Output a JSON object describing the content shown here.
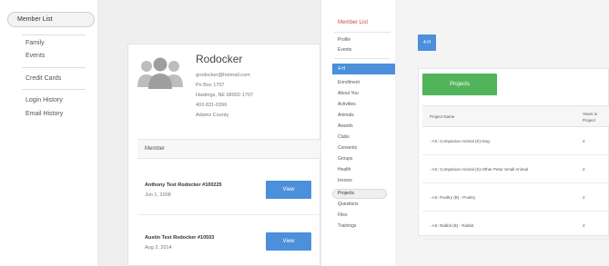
{
  "left": {
    "nav": {
      "active": "Member List",
      "group1": [
        "Family",
        "Events"
      ],
      "group2": [
        "Credit Cards"
      ],
      "group3": [
        "Login History",
        "Email History"
      ]
    },
    "profile": {
      "name": "Rodocker",
      "email": "grodocker@hotmail.com",
      "address1": "Po Box 1707",
      "address2": "Hastings, NE 68902-1707",
      "phone": "402-831-0396",
      "county": "Adams County"
    },
    "member_section": {
      "header": "Member",
      "rows": [
        {
          "name": "Anthony Test Rodocker #100225",
          "date": "Jun 1, 2008",
          "button": "View"
        },
        {
          "name": "Austin Test Rodocker #10503",
          "date": "Aug 2, 2014",
          "button": "View"
        }
      ]
    }
  },
  "right": {
    "sidebar": {
      "heading": "Member List",
      "top_items": [
        "Profile",
        "Events"
      ],
      "active_item": "4-H",
      "items": [
        "Enrollment",
        "About You",
        "Activities",
        "Animals",
        "Awards",
        "Clubs",
        "Consents",
        "Groups",
        "Health",
        "Invoice",
        "Projects",
        "Questions",
        "Files",
        "Trainings"
      ],
      "selected_item": "Projects"
    },
    "badge": "4-H",
    "projects_button": "Projects",
    "table": {
      "headers": {
        "project": "Project Name",
        "years": "Years in Project"
      },
      "rows": [
        {
          "project": "- AS: Companion Animal (K)-Dog",
          "years": "4"
        },
        {
          "project": "- AS: Companion Animal (S)-Other Petor Small Animal",
          "years": "2"
        },
        {
          "project": "- AS: Poultry (B) - Poultry",
          "years": "2"
        },
        {
          "project": "- AS: Rabbit (B) - Rabbit",
          "years": "4"
        }
      ]
    }
  },
  "colors": {
    "accent_blue": "#4c8fdb",
    "project_green": "#52b45a",
    "heading_red": "#d24a4a"
  },
  "icons": {
    "avatar": "people-group-icon"
  }
}
